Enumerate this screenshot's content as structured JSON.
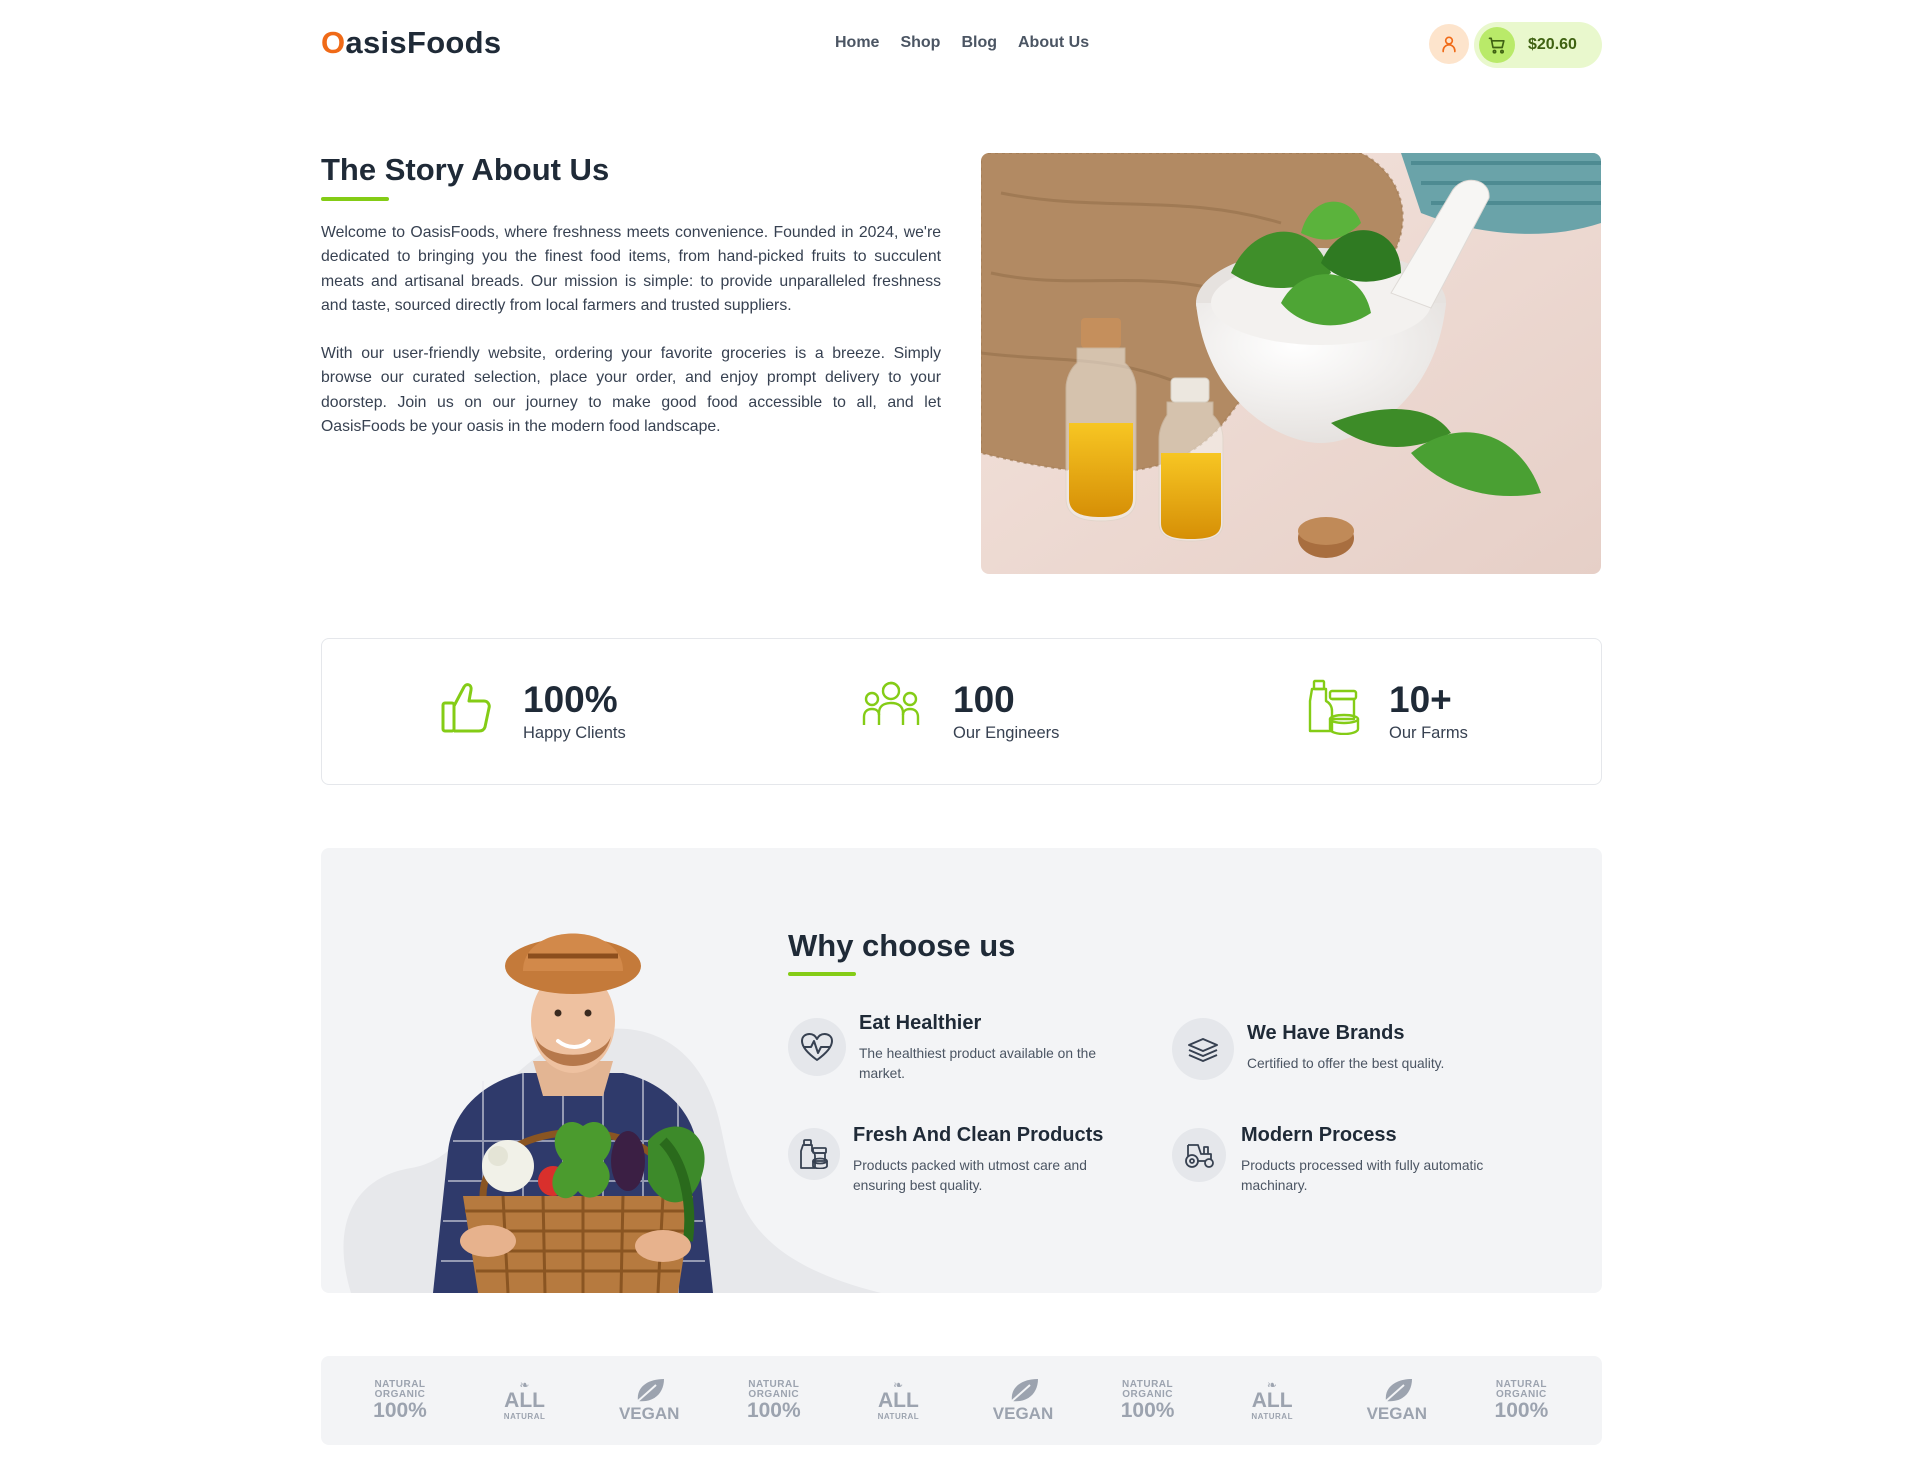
{
  "header": {
    "logo_first": "O",
    "logo_rest": "asisFoods",
    "nav": [
      "Home",
      "Shop",
      "Blog",
      "About Us"
    ],
    "cart_total": "$20.60"
  },
  "story": {
    "title": "The Story About Us",
    "paragraphs": [
      "Welcome to OasisFoods, where freshness meets convenience. Founded in 2024, we're dedicated to bringing you the finest food items, from hand-picked fruits to succulent meats and artisanal breads. Our mission is simple: to provide unparalleled freshness and taste, sourced directly from local farmers and trusted suppliers.",
      "With our user-friendly website, ordering your favorite groceries is a breeze. Simply browse our curated selection, place your order, and enjoy prompt delivery to your doorstep. Join us on our journey to make good food accessible to all, and let OasisFoods be your oasis in the modern food landscape."
    ]
  },
  "stats": [
    {
      "value": "100%",
      "label": "Happy Clients",
      "icon": "thumbs-up-icon"
    },
    {
      "value": "100",
      "label": "Our Engineers",
      "icon": "team-icon"
    },
    {
      "value": "10+",
      "label": "Our Farms",
      "icon": "jars-icon"
    }
  ],
  "why": {
    "title": "Why choose us",
    "features": [
      {
        "title": "Eat Healthier",
        "desc": "The healthiest product available on the market.",
        "icon": "heartbeat-icon"
      },
      {
        "title": "We Have Brands",
        "desc": "Certified to offer the best quality.",
        "icon": "stack-icon"
      },
      {
        "title": "Fresh And Clean Products",
        "desc": "Products packed with utmost care and ensuring best quality.",
        "icon": "canned-food-icon"
      },
      {
        "title": "Modern Process",
        "desc": "Products processed with fully automatic machinary.",
        "icon": "tractor-icon"
      }
    ]
  },
  "badges": [
    {
      "type": "organic",
      "top": "NATURAL",
      "mid": "ORGANIC",
      "big": "100%"
    },
    {
      "type": "all-natural",
      "big": "ALL",
      "small": "NATURAL"
    },
    {
      "type": "vegan",
      "big": "VEGAN"
    },
    {
      "type": "organic",
      "top": "NATURAL",
      "mid": "ORGANIC",
      "big": "100%"
    },
    {
      "type": "all-natural",
      "big": "ALL",
      "small": "NATURAL"
    },
    {
      "type": "vegan",
      "big": "VEGAN"
    },
    {
      "type": "organic",
      "top": "NATURAL",
      "mid": "ORGANIC",
      "big": "100%"
    },
    {
      "type": "all-natural",
      "big": "ALL",
      "small": "NATURAL"
    },
    {
      "type": "vegan",
      "big": "VEGAN"
    },
    {
      "type": "organic",
      "top": "NATURAL",
      "mid": "ORGANIC",
      "big": "100%"
    }
  ],
  "colors": {
    "brand_orange": "#f06a17",
    "accent_green": "#84cc16",
    "cart_bg": "#e9f8cd",
    "text_dark": "#1f2a37"
  }
}
